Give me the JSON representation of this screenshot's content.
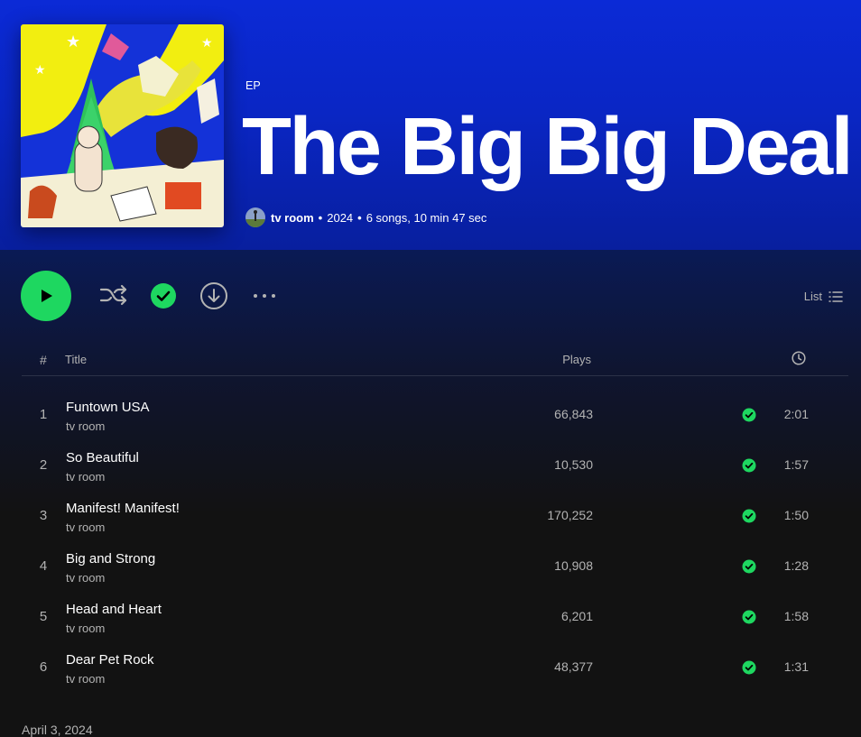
{
  "album": {
    "type": "EP",
    "title": "The Big Big Deal",
    "artist": "tv room",
    "year": "2024",
    "summary": "6 songs, 10 min 47 sec",
    "separator": "•"
  },
  "controls": {
    "list_label": "List",
    "icons": [
      "play-icon",
      "shuffle-icon",
      "saved-check-icon",
      "download-icon",
      "more-options-icon",
      "list-view-icon"
    ]
  },
  "table": {
    "header": {
      "num": "#",
      "title": "Title",
      "plays": "Plays"
    },
    "tracks": [
      {
        "num": "1",
        "title": "Funtown USA",
        "artist": "tv room",
        "plays": "66,843",
        "duration": "2:01"
      },
      {
        "num": "2",
        "title": "So Beautiful",
        "artist": "tv room",
        "plays": "10,530",
        "duration": "1:57"
      },
      {
        "num": "3",
        "title": "Manifest! Manifest!",
        "artist": "tv room",
        "plays": "170,252",
        "duration": "1:50"
      },
      {
        "num": "4",
        "title": "Big and Strong",
        "artist": "tv room",
        "plays": "10,908",
        "duration": "1:28"
      },
      {
        "num": "5",
        "title": "Head and Heart",
        "artist": "tv room",
        "plays": "6,201",
        "duration": "1:58"
      },
      {
        "num": "6",
        "title": "Dear Pet Rock",
        "artist": "tv room",
        "plays": "48,377",
        "duration": "1:31"
      }
    ]
  },
  "footer": {
    "release_date": "April 3, 2024"
  },
  "colors": {
    "accent": "#1ed760",
    "header_bg": "#0b2ad6",
    "background": "#121212",
    "muted": "#b3b3b3"
  }
}
